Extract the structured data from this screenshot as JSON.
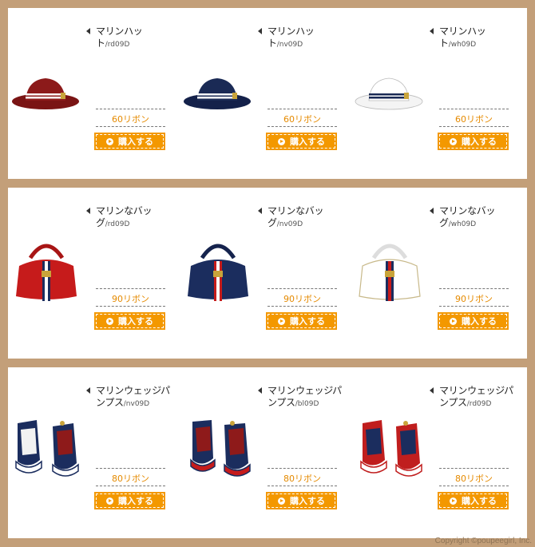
{
  "rows": [
    {
      "category": "hat",
      "items": [
        {
          "name": "マリンハット",
          "code": "/rd09D",
          "price": "60リボン",
          "buy": "購入する",
          "color": "#8c1a1a"
        },
        {
          "name": "マリンハッ\nト",
          "code": "/nv09D",
          "price": "60リボン",
          "buy": "購入する",
          "color": "#1a2a55"
        },
        {
          "name": "マリンハッ\nト",
          "code": "/wh09D",
          "price": "60リボン",
          "buy": "購入する",
          "color": "#ffffff"
        }
      ]
    },
    {
      "category": "bag",
      "items": [
        {
          "name": "マリンなバッ\nグ",
          "code": "/rd09D",
          "price": "90リボン",
          "buy": "購入する",
          "color": "#c61b1b"
        },
        {
          "name": "マリンなバッ\nグ",
          "code": "/nv09D",
          "price": "90リボン",
          "buy": "購入する",
          "color": "#1b2d5e"
        },
        {
          "name": "マリンなバッ\nグ",
          "code": "/wh09D",
          "price": "90リボン",
          "buy": "購入する",
          "color": "#ffffff"
        }
      ]
    },
    {
      "category": "shoes",
      "items": [
        {
          "name": "マリンウェッジパ\nンプス",
          "code": "/nv09D",
          "price": "80リボン",
          "buy": "購入する",
          "color": "#1b2d5e"
        },
        {
          "name": "マリンウェッジパ\nンプス",
          "code": "/bl09D",
          "price": "80リボン",
          "buy": "購入する",
          "color": "#1b2d5e"
        },
        {
          "name": "マリンウェッジパ\nンプス",
          "code": "/rd09D",
          "price": "80リボン",
          "buy": "購入する",
          "color": "#c01e1e"
        }
      ]
    }
  ],
  "copyright": "Copyright ©poupeegirl, Inc."
}
